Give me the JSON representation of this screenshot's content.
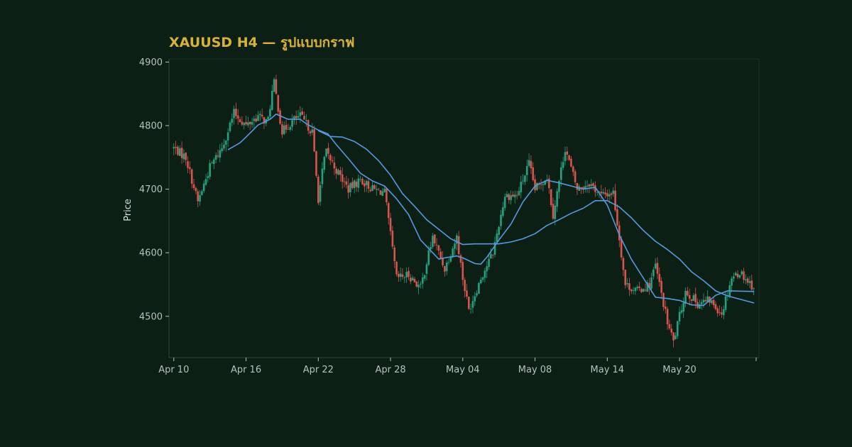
{
  "colors": {
    "background": "#0b1f14",
    "title": "#d9b23a",
    "axis": "#2e4a3c",
    "tick_text": "#b8c2bd",
    "up": "#26a17f",
    "down": "#d9534f",
    "ma": "#5599e0"
  },
  "chart_data": {
    "type": "candlestick",
    "title": "XAUUSD H4 — รูปแบบกราฟ",
    "xlabel": "",
    "ylabel": "Price",
    "symbol": "XAUUSD",
    "timeframe": "H4",
    "ylim": [
      4435,
      4905
    ],
    "yticks": [
      4500,
      4600,
      4700,
      4800,
      4900
    ],
    "xticks": [
      {
        "day": 0,
        "label": "Apr 10"
      },
      {
        "day": 6,
        "label": "Apr 16"
      },
      {
        "day": 12,
        "label": "Apr 22"
      },
      {
        "day": 18,
        "label": "Apr 28"
      },
      {
        "day": 24,
        "label": "May 04"
      },
      {
        "day": 30,
        "label": "May 08"
      },
      {
        "day": 36,
        "label": "May 14"
      },
      {
        "day": 42,
        "label": "May 20"
      }
    ],
    "xlim": [
      -0.4,
      48.6
    ],
    "close_keypoints": [
      [
        0,
        4765
      ],
      [
        1,
        4750
      ],
      [
        2,
        4680
      ],
      [
        3,
        4735
      ],
      [
        4,
        4765
      ],
      [
        5,
        4820
      ],
      [
        6,
        4800
      ],
      [
        7,
        4815
      ],
      [
        7.8,
        4805
      ],
      [
        8.3,
        4870
      ],
      [
        9,
        4790
      ],
      [
        10,
        4810
      ],
      [
        10.5,
        4815
      ],
      [
        11.5,
        4790
      ],
      [
        12,
        4685
      ],
      [
        12.6,
        4760
      ],
      [
        13.5,
        4730
      ],
      [
        14.5,
        4700
      ],
      [
        15.5,
        4715
      ],
      [
        16.5,
        4700
      ],
      [
        17.5,
        4695
      ],
      [
        18.5,
        4560
      ],
      [
        19.5,
        4565
      ],
      [
        20.5,
        4545
      ],
      [
        21.5,
        4625
      ],
      [
        22.5,
        4575
      ],
      [
        23.5,
        4625
      ],
      [
        24,
        4560
      ],
      [
        24.5,
        4510
      ],
      [
        25.5,
        4560
      ],
      [
        26.5,
        4600
      ],
      [
        27.5,
        4690
      ],
      [
        28.5,
        4690
      ],
      [
        29.5,
        4740
      ],
      [
        30,
        4700
      ],
      [
        31,
        4720
      ],
      [
        31.5,
        4660
      ],
      [
        32.5,
        4765
      ],
      [
        33.5,
        4700
      ],
      [
        34.5,
        4710
      ],
      [
        35.5,
        4690
      ],
      [
        36.5,
        4695
      ],
      [
        37.5,
        4550
      ],
      [
        38.5,
        4540
      ],
      [
        39.5,
        4550
      ],
      [
        40,
        4580
      ],
      [
        41,
        4490
      ],
      [
        41.5,
        4460
      ],
      [
        42.5,
        4540
      ],
      [
        43.5,
        4520
      ],
      [
        44.5,
        4525
      ],
      [
        45.5,
        4505
      ],
      [
        46.3,
        4560
      ],
      [
        47,
        4570
      ],
      [
        47.7,
        4555
      ],
      [
        48.2,
        4545
      ]
    ],
    "series": [
      {
        "type": "ma",
        "points": [
          [
            12,
            4792
          ],
          [
            13,
            4783
          ],
          [
            14,
            4782
          ],
          [
            15,
            4775
          ],
          [
            16,
            4763
          ],
          [
            17,
            4745
          ],
          [
            18,
            4722
          ],
          [
            19,
            4693
          ],
          [
            20,
            4673
          ],
          [
            21,
            4652
          ],
          [
            22,
            4637
          ],
          [
            23,
            4622
          ],
          [
            24,
            4613
          ],
          [
            25,
            4614
          ],
          [
            26,
            4614
          ],
          [
            27,
            4614
          ],
          [
            28,
            4617
          ],
          [
            29,
            4622
          ],
          [
            30,
            4630
          ],
          [
            31,
            4643
          ],
          [
            32,
            4652
          ],
          [
            33,
            4662
          ],
          [
            34,
            4670
          ],
          [
            35,
            4682
          ],
          [
            36,
            4682
          ],
          [
            37,
            4672
          ],
          [
            38,
            4655
          ],
          [
            39,
            4635
          ],
          [
            40,
            4618
          ],
          [
            41,
            4605
          ],
          [
            42,
            4590
          ],
          [
            43,
            4570
          ],
          [
            44,
            4556
          ],
          [
            45,
            4540
          ],
          [
            46,
            4532
          ],
          [
            48.2,
            4521
          ]
        ]
      },
      {
        "type": "ma",
        "points": [
          [
            4.5,
            4762
          ],
          [
            5.5,
            4773
          ],
          [
            6,
            4782
          ],
          [
            7,
            4801
          ],
          [
            8,
            4810
          ],
          [
            8.5,
            4818
          ],
          [
            9.5,
            4810
          ],
          [
            10.5,
            4810
          ],
          [
            11,
            4803
          ],
          [
            12,
            4793
          ],
          [
            12.8,
            4787
          ],
          [
            13.5,
            4770
          ],
          [
            14.5,
            4748
          ],
          [
            15.5,
            4725
          ],
          [
            16.5,
            4713
          ],
          [
            17.5,
            4705
          ],
          [
            18.5,
            4685
          ],
          [
            19.5,
            4660
          ],
          [
            20.5,
            4620
          ],
          [
            21.5,
            4600
          ],
          [
            22,
            4590
          ],
          [
            22.5,
            4592
          ],
          [
            23.5,
            4595
          ],
          [
            24,
            4592
          ],
          [
            25,
            4583
          ],
          [
            25.5,
            4582
          ],
          [
            26,
            4593
          ],
          [
            27,
            4620
          ],
          [
            28,
            4645
          ],
          [
            29,
            4680
          ],
          [
            30,
            4705
          ],
          [
            31,
            4714
          ],
          [
            32,
            4710
          ],
          [
            33,
            4705
          ],
          [
            34,
            4700
          ],
          [
            35,
            4703
          ],
          [
            36,
            4675
          ],
          [
            37,
            4628
          ],
          [
            38,
            4590
          ],
          [
            39,
            4560
          ],
          [
            40,
            4530
          ],
          [
            41,
            4528
          ],
          [
            42,
            4525
          ],
          [
            43,
            4518
          ],
          [
            44,
            4517
          ],
          [
            45,
            4533
          ],
          [
            46,
            4540
          ],
          [
            48.2,
            4539
          ]
        ]
      }
    ]
  }
}
